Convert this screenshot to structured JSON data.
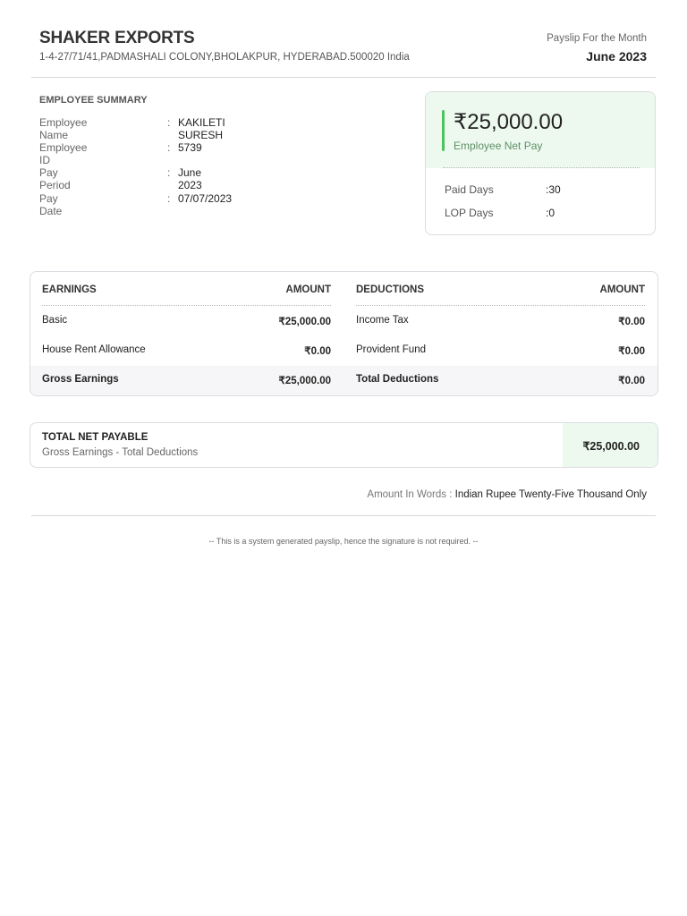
{
  "header": {
    "company": "SHAKER EXPORTS",
    "address": "1-4-27/71/41,PADMASHALI COLONY,BHOLAKPUR, HYDERABAD.500020 India",
    "payslip_label": "Payslip For the Month",
    "month": "June 2023"
  },
  "summary": {
    "title": "EMPLOYEE SUMMARY",
    "rows": [
      {
        "label": "Employee Name",
        "value": "KAKILETI SURESH"
      },
      {
        "label": "Employee ID",
        "value": "5739"
      },
      {
        "label": "Pay Period",
        "value": "June 2023"
      },
      {
        "label": "Pay Date",
        "value": "07/07/2023"
      }
    ],
    "separator": ":"
  },
  "net_card": {
    "amount": "₹25,000.00",
    "label": "Employee Net Pay",
    "paid_days_label": "Paid Days",
    "paid_days": ":30",
    "lop_days_label": "LOP Days",
    "lop_days": ":0"
  },
  "earnings": {
    "header": "EARNINGS",
    "amount_header": "AMOUNT",
    "rows": [
      {
        "label": "Basic",
        "amount": "₹25,000.00"
      },
      {
        "label": "House Rent Allowance",
        "amount": "₹0.00"
      }
    ],
    "total_label": "Gross Earnings",
    "total": "₹25,000.00"
  },
  "deductions": {
    "header": "DEDUCTIONS",
    "amount_header": "AMOUNT",
    "rows": [
      {
        "label": "Income Tax",
        "amount": "₹0.00"
      },
      {
        "label": "Provident Fund",
        "amount": "₹0.00"
      }
    ],
    "total_label": "Total Deductions",
    "total": "₹0.00"
  },
  "net_payable": {
    "title": "TOTAL NET PAYABLE",
    "subtitle": "Gross Earnings - Total Deductions",
    "amount": "₹25,000.00"
  },
  "amount_words": {
    "label": "Amount In Words : ",
    "value": "Indian Rupee Twenty-Five Thousand Only"
  },
  "footer": "-- This is a system generated payslip, hence the signature is not required. --"
}
